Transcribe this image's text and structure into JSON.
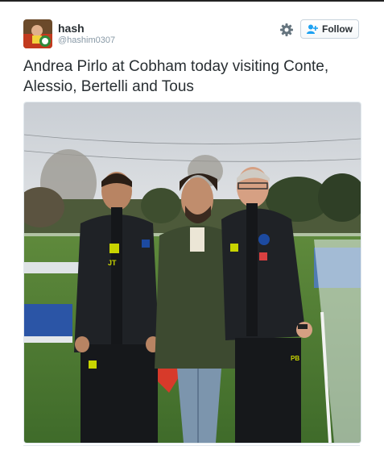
{
  "user": {
    "display_name": "hash",
    "handle": "@hashim0307",
    "avatar_icon": "profile-avatar-icon"
  },
  "actions": {
    "settings_icon": "gear-icon",
    "follow_icon": "add-user-icon",
    "follow_label": "Follow"
  },
  "tweet": {
    "text_line1": "Andrea Pirlo at Cobham today visiting Conte,",
    "text_line2": "Alessio, Bertelli and Tous"
  },
  "photo": {
    "jacket_initials_left": "JT",
    "jacket_initials_right": "PB"
  },
  "colors": {
    "accent_blue": "#1da1f2",
    "text_dark": "#292f33",
    "text_muted": "#8899a6",
    "jacket_badge_yellow": "#c8d400"
  }
}
